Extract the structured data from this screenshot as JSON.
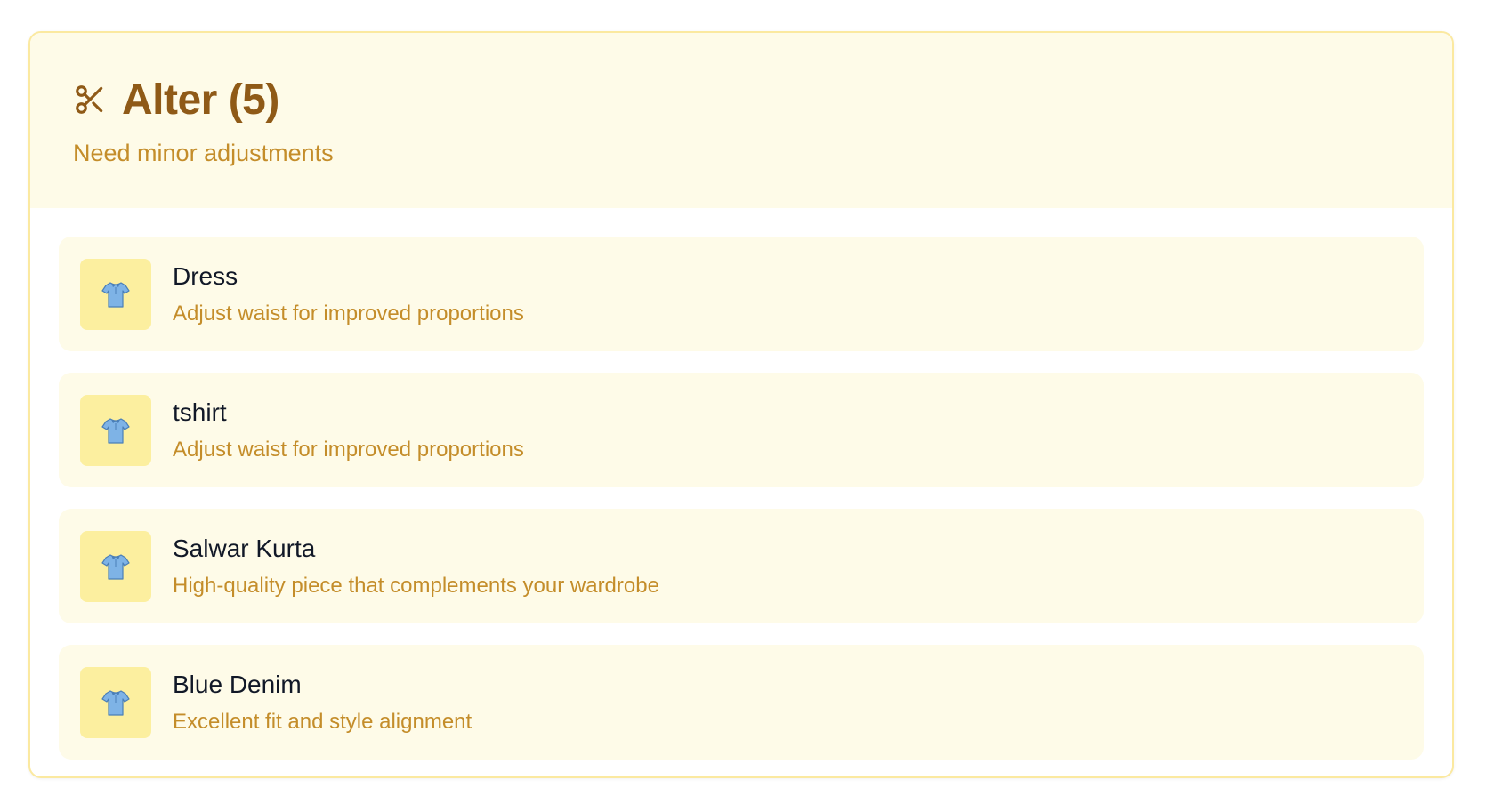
{
  "header": {
    "icon": "scissors-icon",
    "title": "Alter (5)",
    "subtitle": "Need minor adjustments"
  },
  "items": [
    {
      "icon": "tshirt-icon",
      "name": "Dress",
      "description": "Adjust waist for improved proportions"
    },
    {
      "icon": "tshirt-icon",
      "name": "tshirt",
      "description": "Adjust waist for improved proportions"
    },
    {
      "icon": "tshirt-icon",
      "name": "Salwar Kurta",
      "description": "High-quality piece that complements your wardrobe"
    },
    {
      "icon": "tshirt-icon",
      "name": "Blue Denim",
      "description": "Excellent fit and style alignment"
    }
  ],
  "colors": {
    "accent_dark": "#8f5a17",
    "accent_text": "#c48d2a",
    "panel_bg": "#fefbe8",
    "thumb_bg": "#fcef9f",
    "border": "#fbe9a0"
  }
}
